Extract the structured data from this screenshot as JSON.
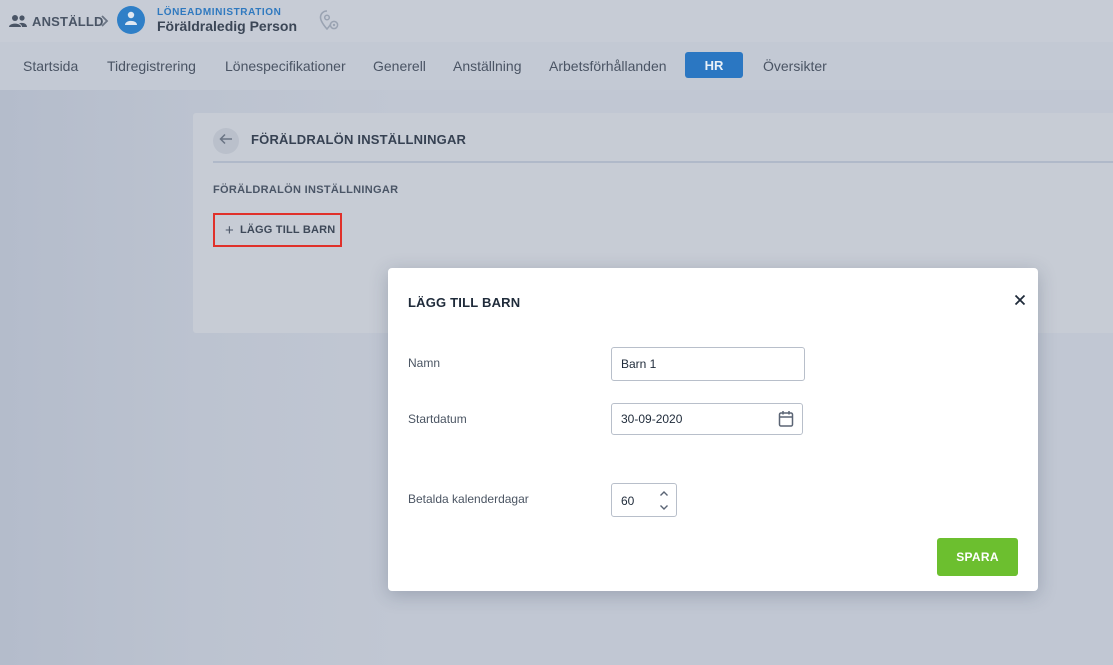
{
  "header": {
    "root_label": "ANSTÄLLD",
    "section_label": "LÖNEADMINISTRATION",
    "person_name": "Föräldraledig Person"
  },
  "tabs": [
    {
      "label": "Startsida"
    },
    {
      "label": "Tidregistrering"
    },
    {
      "label": "Lönespecifikationer"
    },
    {
      "label": "Generell"
    },
    {
      "label": "Anställning"
    },
    {
      "label": "Arbetsförhållanden"
    },
    {
      "label": "HR",
      "active": true
    },
    {
      "label": "Översikter"
    }
  ],
  "panel": {
    "title": "FÖRÄLDRALÖN INSTÄLLNINGAR",
    "section_title": "FÖRÄLDRALÖN INSTÄLLNINGAR",
    "add_child_label": "LÄGG TILL BARN"
  },
  "modal": {
    "title": "LÄGG TILL BARN",
    "fields": {
      "name_label": "Namn",
      "name_value": "Barn 1",
      "start_label": "Startdatum",
      "start_value": "30-09-2020",
      "days_label": "Betalda kalenderdagar",
      "days_value": "60"
    },
    "save_label": "SPARA"
  },
  "colors": {
    "accent": "#2b77c2",
    "save": "#6cbf2f",
    "highlight": "#e0302a"
  },
  "icons": {
    "root": "people-icon",
    "avatar": "person-icon",
    "settings": "location-gear-icon",
    "back": "arrow-left-icon",
    "close": "close-icon",
    "calendar": "calendar-icon"
  }
}
